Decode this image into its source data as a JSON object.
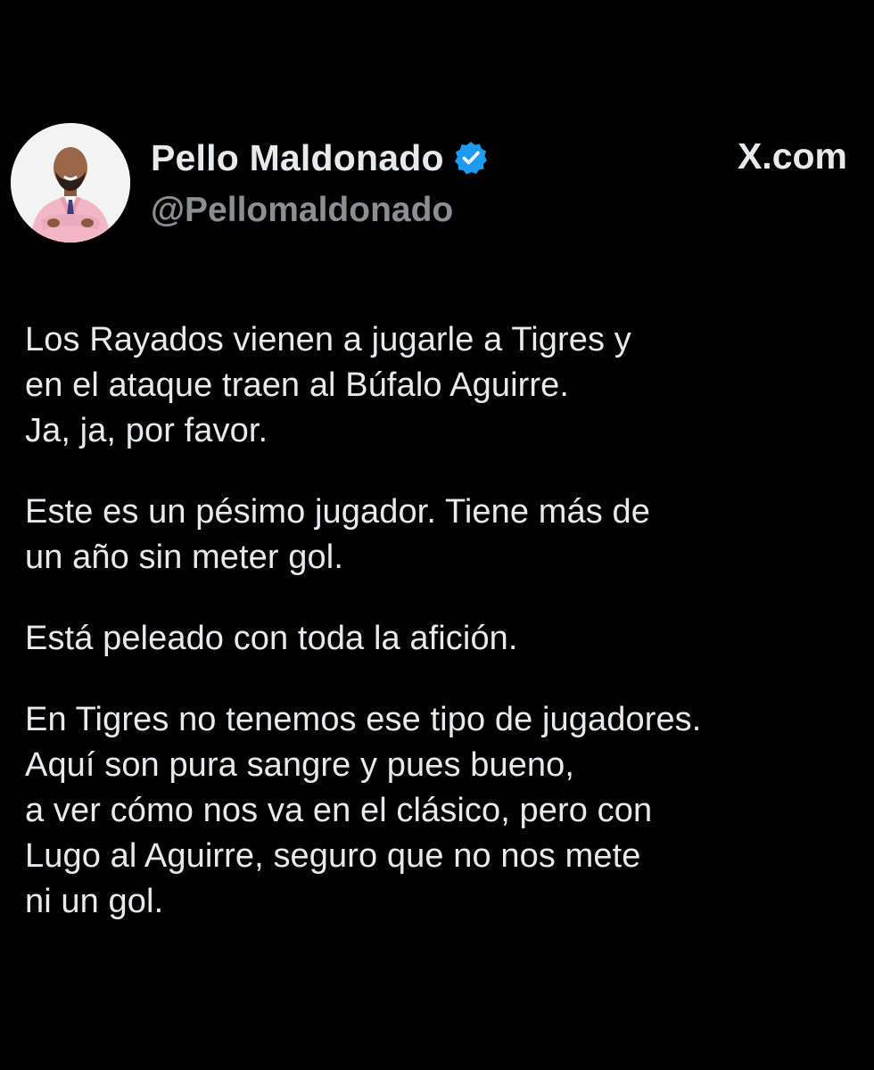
{
  "author": {
    "display_name": "Pello Maldonado",
    "handle": "@Pellomaldonado",
    "verified_icon": "verified-badge-icon",
    "verified_color": "#1d9bf0"
  },
  "brand": {
    "label": "X.com"
  },
  "post": {
    "paragraphs": [
      {
        "lines": [
          "Los Rayados vienen a jugarle a Tigres y",
          "en el ataque traen al Búfalo Aguirre.",
          "Ja, ja, por favor."
        ]
      },
      {
        "lines": [
          "Este es un pésimo jugador. Tiene más de",
          "un año sin meter gol."
        ]
      },
      {
        "lines": [
          "Está peleado con toda la afición."
        ]
      },
      {
        "lines": [
          "En Tigres no tenemos ese tipo de jugadores.",
          "Aquí son pura sangre y pues bueno,",
          "a ver cómo nos va en el clásico, pero con",
          "Lugo al Aguirre, seguro que no nos mete",
          "ni un gol."
        ]
      }
    ]
  },
  "colors": {
    "background": "#000000",
    "text": "#e7e9ea",
    "secondary_text": "#8b8f94"
  }
}
